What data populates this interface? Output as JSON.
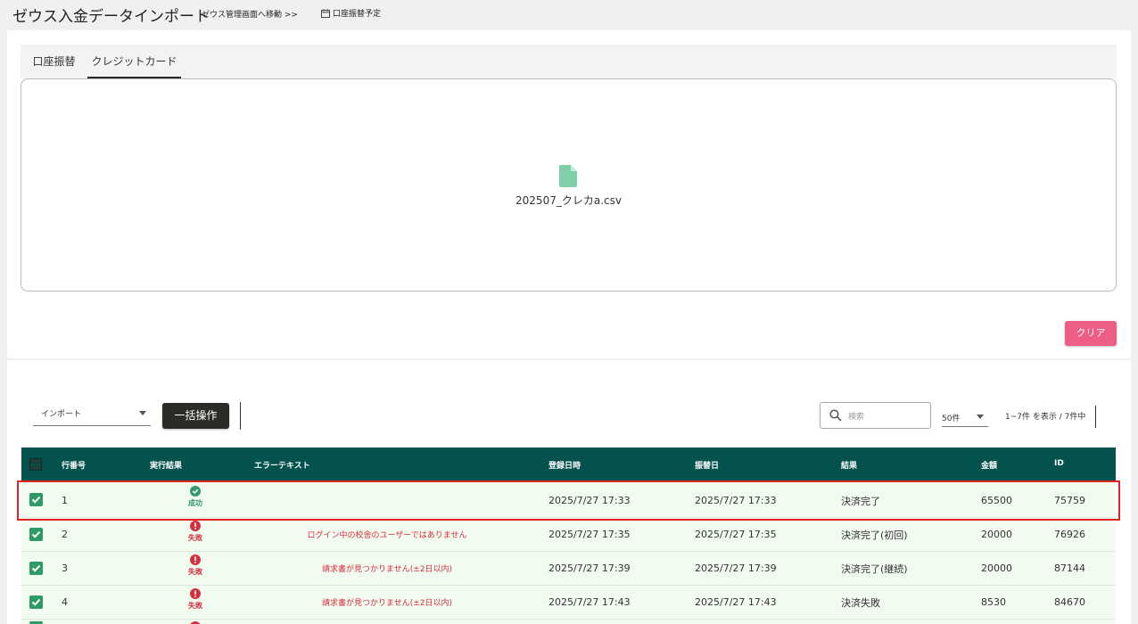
{
  "header": {
    "title": "ゼウス入金データインポート",
    "nav_link": "ゼウス管理画面へ移動 >>",
    "schedule_link": "口座振替予定"
  },
  "tabs": [
    {
      "label": "口座振替",
      "active": false
    },
    {
      "label": "クレジットカード",
      "active": true
    }
  ],
  "upload": {
    "file_name": "202507_クレカa.csv",
    "clear_label": "クリア"
  },
  "toolbar": {
    "import_select": "インポート",
    "bulk_label": "一括操作",
    "search_placeholder": "検索",
    "per_page": "50件",
    "count_text": "1~7件 を表示 / 7件中"
  },
  "table": {
    "columns": [
      "行番号",
      "実行結果",
      "エラーテキスト",
      "登録日時",
      "振替日",
      "結果",
      "金額",
      "ID"
    ],
    "rows": [
      {
        "line": "1",
        "status": "成功",
        "ok": true,
        "error": "",
        "registered": "2025/7/27 17:33",
        "transfer": "2025/7/27 17:33",
        "result": "決済完了",
        "amount": "65500",
        "id": "75759"
      },
      {
        "line": "2",
        "status": "失敗",
        "ok": false,
        "error": "ログイン中の校舎のユーザーではありません",
        "registered": "2025/7/27 17:35",
        "transfer": "2025/7/27 17:35",
        "result": "決済完了(初回)",
        "amount": "20000",
        "id": "76926"
      },
      {
        "line": "3",
        "status": "失敗",
        "ok": false,
        "error": "請求書が見つかりません(±2日以内)",
        "registered": "2025/7/27 17:39",
        "transfer": "2025/7/27 17:39",
        "result": "決済完了(継続)",
        "amount": "20000",
        "id": "87144"
      },
      {
        "line": "4",
        "status": "失敗",
        "ok": false,
        "error": "請求書が見つかりません(±2日以内)",
        "registered": "2025/7/27 17:43",
        "transfer": "2025/7/27 17:43",
        "result": "決済失敗",
        "amount": "8530",
        "id": "84670"
      }
    ]
  },
  "colors": {
    "header_bg": "#03524d",
    "row_bg": "#f1fbef",
    "success": "#2e9a68",
    "failure": "#d32f3f",
    "clear_button": "#ee5d84",
    "highlight": "#e02424"
  }
}
